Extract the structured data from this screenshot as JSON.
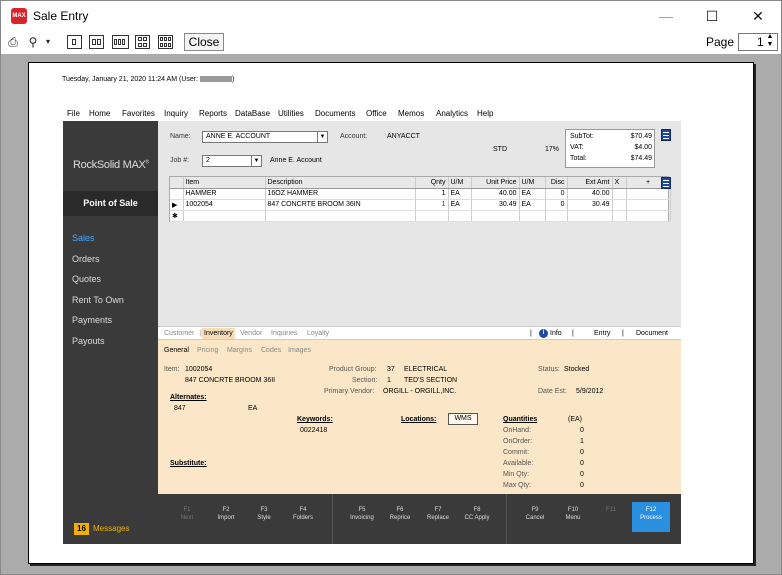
{
  "window": {
    "title": "Sale Entry",
    "app_icon_text": "MAX"
  },
  "toolbar": {
    "close_label": "Close",
    "page_label": "Page",
    "page_value": "1"
  },
  "report": {
    "timestamp": "Tuesday, January 21, 2020 11:24 AM (User:",
    "timestamp_end": ")"
  },
  "menu": [
    "File",
    "Home",
    "Favorites",
    "Inquiry",
    "Reports",
    "DataBase",
    "Utilities",
    "Documents",
    "Office",
    "Memos",
    "Analytics",
    "Help"
  ],
  "sidebar": {
    "brand": "RockSolid MAX",
    "brand_mark": "®",
    "section": "Point of Sale",
    "items": [
      "Sales",
      "Orders",
      "Quotes",
      "Rent To Own",
      "Payments",
      "Payouts"
    ],
    "messages_count": "16",
    "messages_label": "Messages"
  },
  "header": {
    "name_label": "Name:",
    "name_value": "ANNE E. ACCOUNT",
    "account_label": "Account:",
    "account_value": "ANYACCT",
    "job_label": "Job #:",
    "job_value": "2",
    "job_name": "Anne E. Account",
    "price_level": "STD",
    "tax_rate": "17%",
    "subtotal_label": "SubTot:",
    "subtotal_value": "$70.49",
    "vat_label": "VAT:",
    "vat_value": "$4.00",
    "total_label": "Total:",
    "total_value": "$74.49"
  },
  "grid": {
    "columns": [
      "",
      "Item",
      "Description",
      "Qnty",
      "U/M",
      "Unit Price",
      "U/M",
      "Disc",
      "Ext Amt",
      "X",
      "+"
    ],
    "rows": [
      {
        "marker": "",
        "item": "HAMMER",
        "desc": "16OZ HAMMER",
        "qty": "1",
        "um": "EA",
        "price": "40.00",
        "um2": "EA",
        "disc": "0",
        "ext": "40.00"
      },
      {
        "marker": "▶",
        "item": "1002054",
        "desc": "847 CONCRTE BROOM 36IN",
        "qty": "1",
        "um": "EA",
        "price": "30.49",
        "um2": "EA",
        "disc": "0",
        "ext": "30.49"
      }
    ],
    "new_row_marker": "✱"
  },
  "tabs_primary": [
    "Customer",
    "Inventory",
    "Vendor",
    "Inquiries",
    "Loyalty"
  ],
  "tabs_primary_right": [
    "Info",
    "Entry",
    "Document"
  ],
  "tabs_secondary": [
    "General",
    "Pricing",
    "Margins",
    "Codes",
    "Images"
  ],
  "detail": {
    "item_label": "Item:",
    "item_value": "1002054",
    "item_desc": "847 CONCRTE BROOM 36II",
    "product_group_label": "Product Group:",
    "product_group_code": "37",
    "product_group_name": "ELECTRICAL",
    "section_label": "Section:",
    "section_code": "1",
    "section_name": "TED'S SECTION",
    "primary_vendor_label": "Primary Vendor:",
    "primary_vendor_value": "ORGILL - ORGILL,INC.",
    "status_label": "Status:",
    "status_value": "Stocked",
    "date_est_label": "Date Est:",
    "date_est_value": "5/9/2012",
    "alternates_label": "Alternates:",
    "alternate_item": "847",
    "alternate_um": "EA",
    "keywords_label": "Keywords:",
    "keywords_value": "0022418",
    "locations_label": "Locations:",
    "locations_value": "WMS",
    "substitute_label": "Substitute:",
    "quantities_label": "Quantities",
    "quantities_unit": "(EA)",
    "quantities": [
      {
        "label": "OnHand:",
        "value": "0"
      },
      {
        "label": "OnOrder:",
        "value": "1"
      },
      {
        "label": "Commit:",
        "value": "0"
      },
      {
        "label": "Available:",
        "value": "0"
      },
      {
        "label": "Min Qty:",
        "value": "0"
      },
      {
        "label": "Max Qty:",
        "value": "0"
      }
    ]
  },
  "fkeys": [
    {
      "key": "F1",
      "label": "Next",
      "dim": true
    },
    {
      "key": "F2",
      "label": "Import"
    },
    {
      "key": "F3",
      "label": "Style"
    },
    {
      "key": "F4",
      "label": "Folders"
    },
    {
      "key": "F5",
      "label": "Invoicing"
    },
    {
      "key": "F6",
      "label": "Reprice"
    },
    {
      "key": "F7",
      "label": "Replace"
    },
    {
      "key": "F8",
      "label": "CC Apply"
    },
    {
      "key": "F9",
      "label": "Cancel"
    },
    {
      "key": "F10",
      "label": "Menu"
    },
    {
      "key": "F11",
      "label": "",
      "dim": true
    },
    {
      "key": "F12",
      "label": "Process"
    }
  ]
}
